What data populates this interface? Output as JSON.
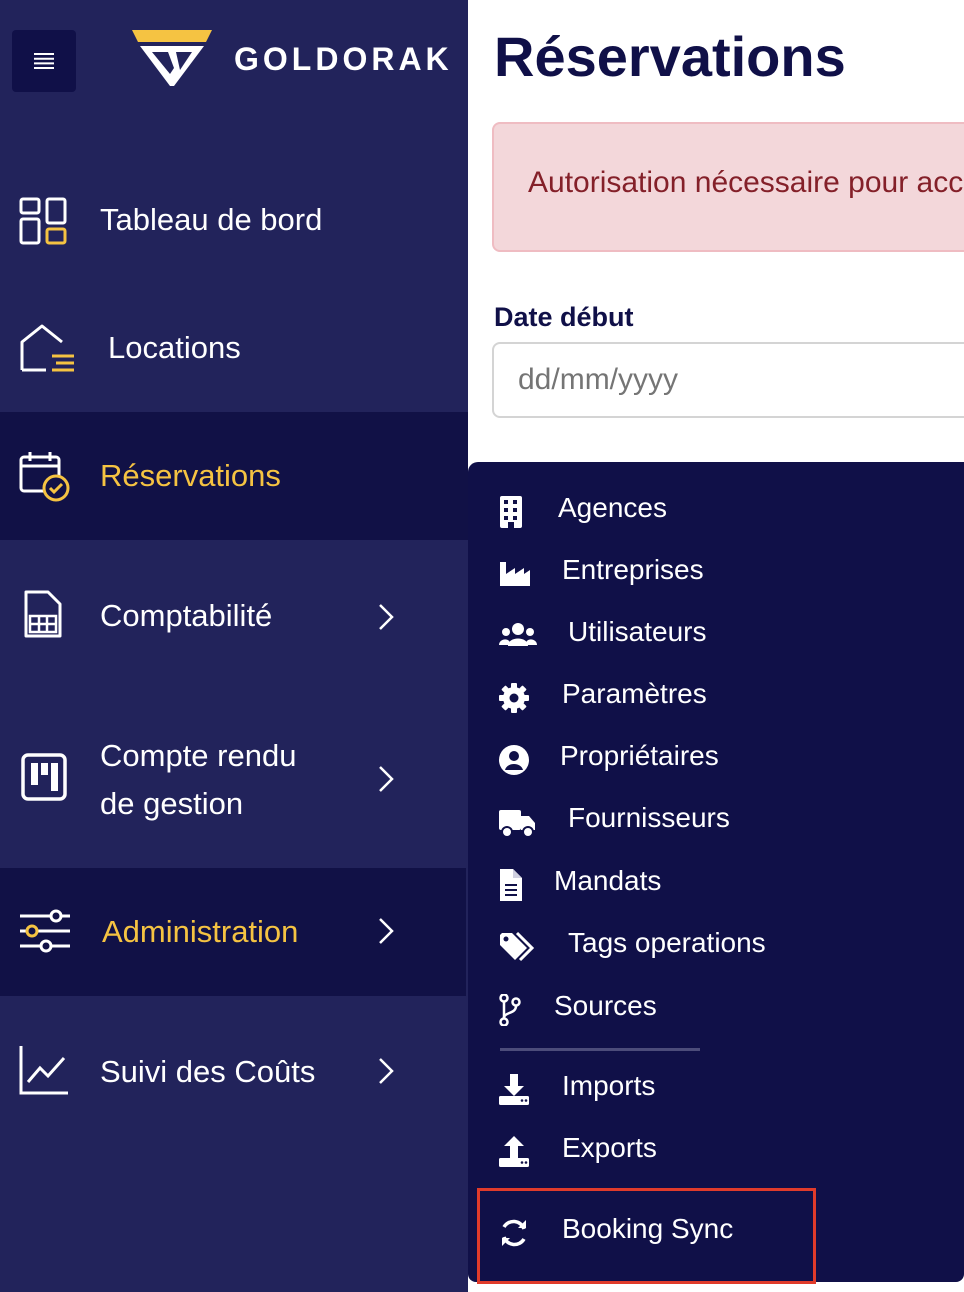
{
  "brand": {
    "name": "GOLDORAK"
  },
  "sidebar": {
    "items": [
      {
        "label": "Tableau de bord",
        "icon": "dashboard-icon"
      },
      {
        "label": "Locations",
        "icon": "house-list-icon"
      },
      {
        "label": "Réservations",
        "icon": "calendar-check-icon",
        "active": true
      },
      {
        "label": "Comptabilité",
        "icon": "spreadsheet-icon",
        "chevron": true
      },
      {
        "label_line1": "Compte rendu",
        "label_line2": "de gestion",
        "icon": "kanban-icon",
        "chevron": true
      },
      {
        "label": "Administration",
        "icon": "sliders-icon",
        "chevron": true,
        "highlighted": true
      },
      {
        "label": "Suivi des Coûts",
        "icon": "line-chart-icon",
        "chevron": true
      }
    ]
  },
  "main": {
    "title": "Réservations",
    "alert": "Autorisation nécessaire pour accéder",
    "date_label": "Date début",
    "date_placeholder": "dd/mm/yyyy"
  },
  "admin_menu": {
    "items": [
      {
        "label": "Agences",
        "icon": "building-icon"
      },
      {
        "label": "Entreprises",
        "icon": "industry-icon"
      },
      {
        "label": "Utilisateurs",
        "icon": "users-icon"
      },
      {
        "label": "Paramètres",
        "icon": "gear-icon"
      },
      {
        "label": "Propriétaires",
        "icon": "user-circle-icon"
      },
      {
        "label": "Fournisseurs",
        "icon": "truck-icon"
      },
      {
        "label": "Mandats",
        "icon": "file-icon"
      },
      {
        "label": "Tags operations",
        "icon": "tags-icon"
      },
      {
        "label": "Sources",
        "icon": "code-branch-icon"
      },
      {
        "label": "Imports",
        "icon": "download-icon"
      },
      {
        "label": "Exports",
        "icon": "upload-icon"
      },
      {
        "label": "Booking Sync",
        "icon": "sync-icon"
      }
    ]
  },
  "colors": {
    "sidebar_bg": "#22235b",
    "active_bg": "#111146",
    "gold": "#f5c342",
    "navy": "#101048",
    "alert_bg": "#f3d7da",
    "alert_text": "#842029",
    "highlight_border": "#e03b2b"
  }
}
